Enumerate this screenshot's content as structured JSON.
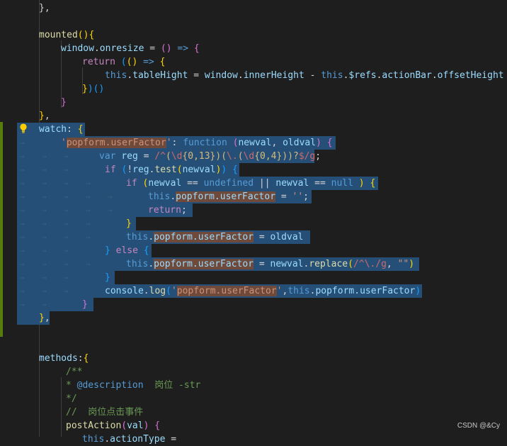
{
  "editor": {
    "lines": [
      {
        "tokens": [
          [
            "p",
            "},"
          ]
        ]
      },
      {
        "tokens": []
      },
      {
        "tokens": [
          [
            "fn",
            "mounted"
          ],
          [
            "y",
            "()"
          ],
          [
            "y",
            "{"
          ]
        ]
      },
      {
        "tokens": [
          [
            "var",
            "window"
          ],
          [
            "p",
            "."
          ],
          [
            "var",
            "onresize"
          ],
          [
            "p",
            " = "
          ],
          [
            "m",
            "()"
          ],
          [
            "p",
            " "
          ],
          [
            "kw",
            "=>"
          ],
          [
            "p",
            " "
          ],
          [
            "m",
            "{"
          ]
        ]
      },
      {
        "tokens": [
          [
            "ctrl",
            "return"
          ],
          [
            "p",
            " "
          ],
          [
            "b",
            "("
          ],
          [
            "y",
            "()"
          ],
          [
            "p",
            " "
          ],
          [
            "kw",
            "=>"
          ],
          [
            "p",
            " "
          ],
          [
            "y",
            "{"
          ]
        ]
      },
      {
        "tokens": [
          [
            "kw",
            "this"
          ],
          [
            "p",
            "."
          ],
          [
            "var",
            "tableHight"
          ],
          [
            "p",
            " = "
          ],
          [
            "var",
            "window"
          ],
          [
            "p",
            "."
          ],
          [
            "var",
            "innerHeight"
          ],
          [
            "p",
            " - "
          ],
          [
            "kw",
            "this"
          ],
          [
            "p",
            "."
          ],
          [
            "var",
            "$refs"
          ],
          [
            "p",
            "."
          ],
          [
            "var",
            "actionBar"
          ],
          [
            "p",
            "."
          ],
          [
            "var",
            "offsetHeight"
          ],
          [
            "p",
            " -"
          ]
        ]
      },
      {
        "tokens": [
          [
            "y",
            "}"
          ],
          [
            "b",
            ")"
          ],
          [
            "b",
            "()"
          ]
        ]
      },
      {
        "tokens": [
          [
            "m",
            "}"
          ]
        ]
      },
      {
        "tokens": [
          [
            "y",
            "}"
          ],
          [
            "p",
            ","
          ]
        ]
      },
      {
        "tokens": [
          [
            "var",
            "watch"
          ],
          [
            "p",
            ": "
          ],
          [
            "y",
            "{"
          ]
        ]
      },
      {
        "tokens": [
          [
            "str",
            "'"
          ],
          [
            "hl:str",
            "popform.userFactor"
          ],
          [
            "str",
            "'"
          ],
          [
            "p",
            ": "
          ],
          [
            "kw",
            "function"
          ],
          [
            "p",
            " "
          ],
          [
            "m",
            "("
          ],
          [
            "var",
            "newval"
          ],
          [
            "p",
            ", "
          ],
          [
            "var",
            "oldval"
          ],
          [
            "m",
            ")"
          ],
          [
            "p",
            " "
          ],
          [
            "m",
            "{"
          ]
        ]
      },
      {
        "tokens": [
          [
            "kw",
            "var"
          ],
          [
            "p",
            " "
          ],
          [
            "var",
            "reg"
          ],
          [
            "p",
            " = "
          ],
          [
            "rx",
            "/^"
          ],
          [
            "rxe",
            "("
          ],
          [
            "rx",
            "\\d"
          ],
          [
            "rxe",
            "{0,13}"
          ],
          [
            "rxe",
            ")"
          ],
          [
            "rxe",
            "("
          ],
          [
            "rx",
            "\\."
          ],
          [
            "rxe",
            "("
          ],
          [
            "rx",
            "\\d"
          ],
          [
            "rxe",
            "{0,4}"
          ],
          [
            "rxe",
            "))?"
          ],
          [
            "rx",
            "$/g"
          ],
          [
            "p",
            ";"
          ]
        ]
      },
      {
        "tokens": [
          [
            "ctrl",
            "if"
          ],
          [
            "p",
            " "
          ],
          [
            "b",
            "("
          ],
          [
            "p",
            "!"
          ],
          [
            "var",
            "reg"
          ],
          [
            "p",
            "."
          ],
          [
            "fn",
            "test"
          ],
          [
            "y",
            "("
          ],
          [
            "var",
            "newval"
          ],
          [
            "y",
            ")"
          ],
          [
            "b",
            ")"
          ],
          [
            "p",
            " "
          ],
          [
            "b",
            "{"
          ]
        ]
      },
      {
        "tokens": [
          [
            "ctrl",
            "if"
          ],
          [
            "p",
            " "
          ],
          [
            "y",
            "("
          ],
          [
            "var",
            "newval"
          ],
          [
            "p",
            " == "
          ],
          [
            "kw",
            "undefined"
          ],
          [
            "p",
            " || "
          ],
          [
            "var",
            "newval"
          ],
          [
            "p",
            " == "
          ],
          [
            "kw",
            "null"
          ],
          [
            "p",
            " "
          ],
          [
            "y",
            ")"
          ],
          [
            "p",
            " "
          ],
          [
            "y",
            "{"
          ]
        ]
      },
      {
        "tokens": [
          [
            "kw",
            "this"
          ],
          [
            "p",
            "."
          ],
          [
            "hl:var",
            "popform.userFactor"
          ],
          [
            "p",
            " = "
          ],
          [
            "str",
            "''"
          ],
          [
            "p",
            ";"
          ]
        ]
      },
      {
        "tokens": [
          [
            "ctrl",
            "return"
          ],
          [
            "p",
            ";"
          ]
        ]
      },
      {
        "tokens": [
          [
            "y",
            "}"
          ]
        ]
      },
      {
        "tokens": [
          [
            "kw",
            "this"
          ],
          [
            "p",
            "."
          ],
          [
            "hl:var",
            "popform.userFactor"
          ],
          [
            "p",
            " = "
          ],
          [
            "var",
            "oldval"
          ]
        ]
      },
      {
        "tokens": [
          [
            "b",
            "}"
          ],
          [
            "p",
            " "
          ],
          [
            "ctrl",
            "else"
          ],
          [
            "p",
            " "
          ],
          [
            "b",
            "{"
          ]
        ]
      },
      {
        "tokens": [
          [
            "kw",
            "this"
          ],
          [
            "p",
            "."
          ],
          [
            "hl:var",
            "popform.userFactor"
          ],
          [
            "p",
            " = "
          ],
          [
            "var",
            "newval"
          ],
          [
            "p",
            "."
          ],
          [
            "fn",
            "replace"
          ],
          [
            "y",
            "("
          ],
          [
            "rx",
            "/^\\./g"
          ],
          [
            "p",
            ", "
          ],
          [
            "str",
            "\"\""
          ],
          [
            "y",
            ")"
          ]
        ]
      },
      {
        "tokens": [
          [
            "b",
            "}"
          ]
        ]
      },
      {
        "tokens": [
          [
            "var",
            "console"
          ],
          [
            "p",
            "."
          ],
          [
            "fn",
            "log"
          ],
          [
            "b",
            "("
          ],
          [
            "str",
            "'"
          ],
          [
            "hl:str",
            "popform.userFactor"
          ],
          [
            "str",
            "'"
          ],
          [
            "p",
            ","
          ],
          [
            "kw",
            "this"
          ],
          [
            "p",
            "."
          ],
          [
            "var",
            "popform.userFactor"
          ],
          [
            "b",
            ")"
          ]
        ]
      },
      {
        "tokens": [
          [
            "m",
            "}"
          ]
        ]
      },
      {
        "tokens": [
          [
            "y",
            "}"
          ],
          [
            "p",
            ","
          ]
        ]
      },
      {
        "tokens": []
      },
      {
        "tokens": []
      },
      {
        "tokens": [
          [
            "var",
            "methods"
          ],
          [
            "p",
            ":"
          ],
          [
            "y",
            "{"
          ]
        ]
      },
      {
        "tokens": [
          [
            "cm",
            "/**"
          ]
        ]
      },
      {
        "tokens": [
          [
            "cm",
            "* "
          ],
          [
            "kw",
            "@description"
          ],
          [
            "cm",
            "  岗位 -str"
          ]
        ]
      },
      {
        "tokens": [
          [
            "cm",
            "*/"
          ]
        ]
      },
      {
        "tokens": [
          [
            "cm",
            "//  岗位点击事件"
          ]
        ]
      },
      {
        "tokens": [
          [
            "fn",
            "postAction"
          ],
          [
            "m",
            "("
          ],
          [
            "var",
            "val"
          ],
          [
            "m",
            ")"
          ],
          [
            "p",
            " "
          ],
          [
            "m",
            "{"
          ]
        ]
      },
      {
        "tokens": [
          [
            "kw",
            "this"
          ],
          [
            "p",
            "."
          ],
          [
            "var",
            "actionType"
          ],
          [
            "p",
            " = "
          ]
        ]
      }
    ]
  },
  "watermark": "CSDN @&Cy"
}
